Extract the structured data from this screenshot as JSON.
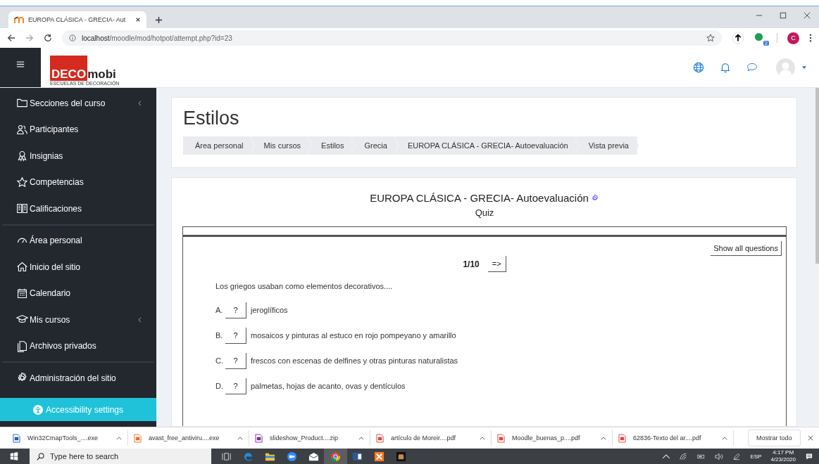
{
  "browser": {
    "tab_title": "EUROPA CLÁSICA - GRECIA- Aut",
    "url_host": "localhost",
    "url_path": "/moodle/mod/hotpot/attempt.php?id=23",
    "extension_badge": "2",
    "profile_initial": "C"
  },
  "header": {
    "logo_red": "DECO",
    "logo_dark": "mobi",
    "logo_tagline": "ESCUELAS DE DECORACIÓN"
  },
  "sidebar": {
    "groups": [
      [
        {
          "label": "Secciones del curso",
          "expandable": true
        },
        {
          "label": "Participantes",
          "expandable": false
        },
        {
          "label": "Insignias",
          "expandable": false
        },
        {
          "label": "Competencias",
          "expandable": false
        },
        {
          "label": "Calificaciones",
          "expandable": false
        }
      ],
      [
        {
          "label": "Área personal",
          "expandable": false
        },
        {
          "label": "Inicio del sitio",
          "expandable": false
        },
        {
          "label": "Calendario",
          "expandable": false
        },
        {
          "label": "Mis cursos",
          "expandable": true
        },
        {
          "label": "Archivos privados",
          "expandable": false
        }
      ],
      [
        {
          "label": "Administración del sitio",
          "expandable": false
        }
      ]
    ],
    "accessibility": "Accessibility settings"
  },
  "page": {
    "title": "Estilos",
    "breadcrumbs": [
      "Área personal",
      "Mis cursos",
      "Estilos",
      "Grecia",
      "EUROPA CLÁSICA - GRECIA- Autoevaluación",
      "Vista previa"
    ]
  },
  "quiz": {
    "title": "EUROPA CLÁSICA - GRECIA- Autoevaluación",
    "subtitle": "Quiz",
    "show_all": "Show all questions",
    "counter": "1/10",
    "next": "=>",
    "question": "Los griegos usaban como elementos decorativos....",
    "options": [
      {
        "letter": "A.",
        "answer": "?",
        "text": "jeroglíficos"
      },
      {
        "letter": "B.",
        "answer": "?",
        "text": "mosaicos y pinturas al estuco en rojo pompeyano y amarillo"
      },
      {
        "letter": "C.",
        "answer": "?",
        "text": "frescos con escenas de delfines y otras pinturas naturalistas"
      },
      {
        "letter": "D.",
        "answer": "?",
        "text": "palmetas, hojas de acanto, ovas y dentículos"
      }
    ]
  },
  "downloads": {
    "items": [
      {
        "name": "Win32CmapTools_....exe",
        "color": "#1f5fa8"
      },
      {
        "name": "avast_free_antiviru....exe",
        "color": "#f26b1d"
      },
      {
        "name": "slideshow_Product....zip",
        "color": "#7a2f8f"
      },
      {
        "name": "artículo de Moreir....pdf",
        "color": "#e0453a"
      },
      {
        "name": "Moodle_buenas_p....pdf",
        "color": "#e0453a"
      },
      {
        "name": "62836-Texto del ar....pdf",
        "color": "#e0453a"
      }
    ],
    "show_all": "Mostrar todo"
  },
  "taskbar": {
    "search_placeholder": "Type here to search",
    "language": "ESP",
    "time": "4:17 PM",
    "date": "4/23/2020"
  }
}
